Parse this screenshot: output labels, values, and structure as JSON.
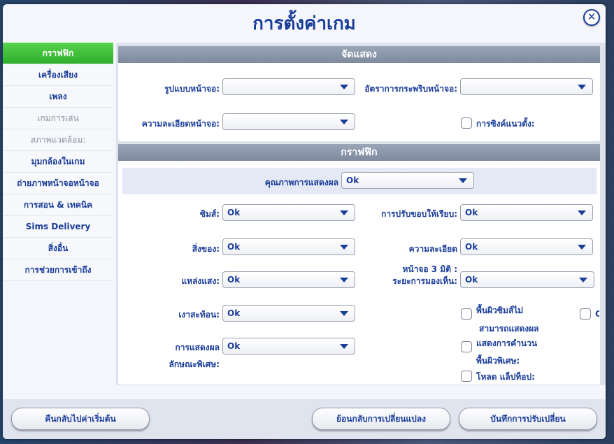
{
  "window": {
    "title": "การตั้งค่าเกม",
    "close_symbol": "✕"
  },
  "sidebar": {
    "items": [
      {
        "label": "กราฟฟิก",
        "state": "active"
      },
      {
        "label": "เครื่องเสียง",
        "state": "normal"
      },
      {
        "label": "เพลง",
        "state": "normal"
      },
      {
        "label": "เกมการเล่น",
        "state": "disabled"
      },
      {
        "label": "สภาพแวดล้อม:",
        "state": "disabled"
      },
      {
        "label": "มุมกล้องในเกม",
        "state": "normal"
      },
      {
        "label": "ถ่ายภาพหน้าจอหน้าจอ",
        "state": "normal"
      },
      {
        "label": "การสอน & เทคนิค",
        "state": "normal"
      },
      {
        "label": "Sims Delivery",
        "state": "normal"
      },
      {
        "label": "สิ่งอื่น",
        "state": "normal"
      },
      {
        "label": "การช่วยการเข้าถึง",
        "state": "normal"
      }
    ]
  },
  "display": {
    "header": "จัดแสดง",
    "screen_mode_label": "รูปแบบหน้าจอ:",
    "screen_mode_value": "",
    "refresh_rate_label": "อัตราการกระพริบหน้าจอ:",
    "refresh_rate_value": "",
    "resolution_label": "ความละเอียดหน้าจอ:",
    "resolution_value": "",
    "vsync_label": "การซิงค์แนวตั้ง:"
  },
  "graphics": {
    "header": "กราฟฟิก",
    "quality_label": "คุณภาพการแสดงผล",
    "quality_value": "Ok",
    "sims_label": "ซิมส์:",
    "sims_value": "Ok",
    "edge_label": "การปรับขอบให้เรียบ:",
    "edge_value": "Ok",
    "objects_label": "สิ่งของ:",
    "objects_value": "Ok",
    "detail_label": "ความละเอียด",
    "detail_value": "Ok",
    "lighting_label": "แหล่งแสง:",
    "lighting_value": "Ok",
    "view_line1": "หน้าจอ 3 มิติ :",
    "view_line2": "ระยะการมองเห็น:",
    "view_value": "Ok",
    "reflections_label": "เงาสะท้อน:",
    "reflections_value": "Ok",
    "effects_label": "การแสดงผล",
    "effects_label2": "ลักษณะพิเศษ:",
    "effects_value": "Ok",
    "sim_surface_line1": "พื้นผิวซิมส์ไม่",
    "sim_surface_line2": "สามารถแสดงผล",
    "calc_line1": "แสดงการคำนวน",
    "calc_line2": "พื้นผิวพิเศษ:",
    "laptop_label": "โหลด แล็ปท็อป:",
    "cut_checkbox_label": "C"
  },
  "footer": {
    "reset_defaults": "คืนกลับไปค่าเริ่มต้น",
    "undo_changes": "ย้อนกลับการเปลี่ยนแปลง",
    "save_changes": "บันทึกการปรับเปลี่ยน"
  },
  "colors": {
    "accent": "#1a3d99",
    "active_tab": "#3cbf38",
    "header_bar": "#8a95aa"
  }
}
